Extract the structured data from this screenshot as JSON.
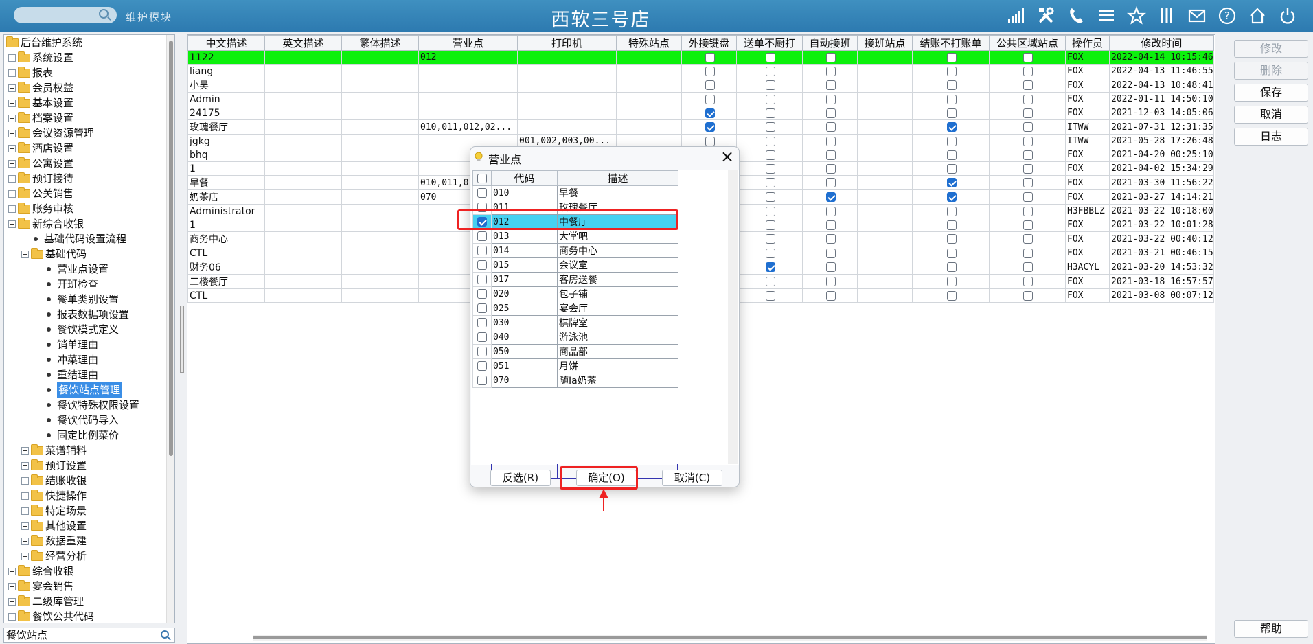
{
  "topbar": {
    "search_placeholder": "",
    "module_label": "维护模块",
    "store_title": "西软三号店",
    "icons": [
      "signal-icon",
      "tools-icon",
      "phone-icon",
      "menu-icon",
      "star-icon",
      "columns-icon",
      "mail-icon",
      "help-icon",
      "home-icon",
      "power-icon"
    ]
  },
  "tree": {
    "items": [
      {
        "label": "后台维护系统",
        "type": "root"
      },
      {
        "label": "系统设置",
        "type": "folder",
        "state": "plus"
      },
      {
        "label": "报表",
        "type": "folder",
        "state": "plus"
      },
      {
        "label": "会员权益",
        "type": "folder",
        "state": "plus"
      },
      {
        "label": "基本设置",
        "type": "folder",
        "state": "plus"
      },
      {
        "label": "档案设置",
        "type": "folder",
        "state": "plus"
      },
      {
        "label": "会议资源管理",
        "type": "folder",
        "state": "plus"
      },
      {
        "label": "酒店设置",
        "type": "folder",
        "state": "plus"
      },
      {
        "label": "公寓设置",
        "type": "folder",
        "state": "plus"
      },
      {
        "label": "预订接待",
        "type": "folder",
        "state": "plus"
      },
      {
        "label": "公关销售",
        "type": "folder",
        "state": "plus"
      },
      {
        "label": "账务审核",
        "type": "folder",
        "state": "plus"
      },
      {
        "label": "新综合收银",
        "type": "folder",
        "state": "minus"
      },
      {
        "label": "基础代码设置流程",
        "type": "leaf",
        "level": 1
      },
      {
        "label": "基础代码",
        "type": "folder",
        "state": "minus",
        "level": 1
      },
      {
        "label": "营业点设置",
        "type": "leaf",
        "level": 2
      },
      {
        "label": "开班检查",
        "type": "leaf",
        "level": 2
      },
      {
        "label": "餐单类别设置",
        "type": "leaf",
        "level": 2
      },
      {
        "label": "报表数据项设置",
        "type": "leaf",
        "level": 2
      },
      {
        "label": "餐饮模式定义",
        "type": "leaf",
        "level": 2
      },
      {
        "label": "销单理由",
        "type": "leaf",
        "level": 2
      },
      {
        "label": "冲菜理由",
        "type": "leaf",
        "level": 2
      },
      {
        "label": "重结理由",
        "type": "leaf",
        "level": 2
      },
      {
        "label": "餐饮站点管理",
        "type": "leaf",
        "level": 2,
        "selected": true
      },
      {
        "label": "餐饮特殊权限设置",
        "type": "leaf",
        "level": 2
      },
      {
        "label": "餐饮代码导入",
        "type": "leaf",
        "level": 2
      },
      {
        "label": "固定比例菜价",
        "type": "leaf",
        "level": 2
      },
      {
        "label": "菜谱辅料",
        "type": "folder",
        "state": "plus",
        "level": 1
      },
      {
        "label": "预订设置",
        "type": "folder",
        "state": "plus",
        "level": 1
      },
      {
        "label": "结账收银",
        "type": "folder",
        "state": "plus",
        "level": 1
      },
      {
        "label": "快捷操作",
        "type": "folder",
        "state": "plus",
        "level": 1
      },
      {
        "label": "特定场景",
        "type": "folder",
        "state": "plus",
        "level": 1
      },
      {
        "label": "其他设置",
        "type": "folder",
        "state": "plus",
        "level": 1
      },
      {
        "label": "数据重建",
        "type": "folder",
        "state": "plus",
        "level": 1
      },
      {
        "label": "经营分析",
        "type": "folder",
        "state": "plus",
        "level": 1
      },
      {
        "label": "综合收银",
        "type": "folder",
        "state": "plus"
      },
      {
        "label": "宴会销售",
        "type": "folder",
        "state": "plus"
      },
      {
        "label": "二级库管理",
        "type": "folder",
        "state": "plus"
      },
      {
        "label": "餐饮公共代码",
        "type": "folder",
        "state": "plus"
      }
    ],
    "search_value": "餐饮站点"
  },
  "grid": {
    "columns": [
      "中文描述",
      "英文描述",
      "繁体描述",
      "营业点",
      "打印机",
      "特殊站点",
      "外接键盘",
      "送单不厨打",
      "自动接班",
      "接班站点",
      "结账不打账单",
      "公共区域站点",
      "操作员",
      "修改时间"
    ],
    "rows": [
      {
        "cn": "1122",
        "en": "",
        "tw": "",
        "outlet": "012",
        "printer": "",
        "special": "",
        "kb": false,
        "nokit": false,
        "auto": false,
        "site": "",
        "nobill": false,
        "pub": false,
        "op": "FOX",
        "time": "2022-04-14 10:15:46"
      },
      {
        "cn": "liang",
        "en": "",
        "tw": "",
        "outlet": "",
        "printer": "",
        "special": "",
        "kb": false,
        "nokit": false,
        "auto": false,
        "site": "",
        "nobill": false,
        "pub": false,
        "op": "FOX",
        "time": "2022-04-13 11:46:55"
      },
      {
        "cn": "小吴",
        "en": "",
        "tw": "",
        "outlet": "",
        "printer": "",
        "special": "",
        "kb": false,
        "nokit": false,
        "auto": false,
        "site": "",
        "nobill": false,
        "pub": false,
        "op": "FOX",
        "time": "2022-04-13 10:48:41"
      },
      {
        "cn": "Admin",
        "en": "",
        "tw": "",
        "outlet": "",
        "printer": "",
        "special": "",
        "kb": false,
        "nokit": false,
        "auto": false,
        "site": "",
        "nobill": false,
        "pub": false,
        "op": "FOX",
        "time": "2022-01-11 14:50:10"
      },
      {
        "cn": "24175",
        "en": "",
        "tw": "",
        "outlet": "",
        "printer": "",
        "special": "",
        "kb": true,
        "nokit": false,
        "auto": false,
        "site": "",
        "nobill": false,
        "pub": false,
        "op": "FOX",
        "time": "2021-12-03 14:05:06"
      },
      {
        "cn": "玫瑰餐厅",
        "en": "",
        "tw": "",
        "outlet": "010,011,012,02...",
        "printer": "",
        "special": "",
        "kb": true,
        "nokit": false,
        "auto": false,
        "site": "",
        "nobill": true,
        "pub": false,
        "op": "ITWW",
        "time": "2021-07-31 12:31:35"
      },
      {
        "cn": "jgkg",
        "en": "",
        "tw": "",
        "outlet": "",
        "printer": "001,002,003,00...",
        "special": "",
        "kb": false,
        "nokit": false,
        "auto": false,
        "site": "",
        "nobill": false,
        "pub": false,
        "op": "ITWW",
        "time": "2021-05-28 17:26:48"
      },
      {
        "cn": "bhq",
        "en": "",
        "tw": "",
        "outlet": "",
        "printer": "",
        "special": "",
        "kb": false,
        "nokit": false,
        "auto": false,
        "site": "",
        "nobill": false,
        "pub": false,
        "op": "FOX",
        "time": "2021-04-20 00:25:10"
      },
      {
        "cn": "1",
        "en": "",
        "tw": "",
        "outlet": "",
        "printer": "",
        "special": "",
        "kb": false,
        "nokit": false,
        "auto": false,
        "site": "",
        "nobill": false,
        "pub": false,
        "op": "FOX",
        "time": "2021-04-02 15:34:29"
      },
      {
        "cn": "早餐",
        "en": "",
        "tw": "",
        "outlet": "010,011,0",
        "printer": "",
        "special": "",
        "kb": false,
        "nokit": false,
        "auto": false,
        "site": "",
        "nobill": true,
        "pub": false,
        "op": "FOX",
        "time": "2021-03-30 11:56:22"
      },
      {
        "cn": "奶茶店",
        "en": "",
        "tw": "",
        "outlet": "070",
        "printer": "",
        "special": "",
        "kb": false,
        "nokit": false,
        "auto": true,
        "site": "",
        "nobill": true,
        "pub": false,
        "op": "FOX",
        "time": "2021-03-27 14:14:21"
      },
      {
        "cn": "Administrator",
        "en": "",
        "tw": "",
        "outlet": "",
        "printer": "",
        "special": "",
        "kb": false,
        "nokit": false,
        "auto": false,
        "site": "",
        "nobill": false,
        "pub": false,
        "op": "H3FBBLZ",
        "time": "2021-03-22 10:18:00"
      },
      {
        "cn": "1",
        "en": "",
        "tw": "",
        "outlet": "",
        "printer": "",
        "special": "",
        "kb": false,
        "nokit": false,
        "auto": false,
        "site": "",
        "nobill": false,
        "pub": false,
        "op": "FOX",
        "time": "2021-03-22 10:01:28"
      },
      {
        "cn": "商务中心",
        "en": "",
        "tw": "",
        "outlet": "",
        "printer": "",
        "special": "",
        "kb": false,
        "nokit": false,
        "auto": false,
        "site": "",
        "nobill": false,
        "pub": false,
        "op": "FOX",
        "time": "2021-03-22 00:40:12"
      },
      {
        "cn": "CTL",
        "en": "",
        "tw": "",
        "outlet": "",
        "printer": "",
        "special": "",
        "kb": false,
        "nokit": false,
        "auto": false,
        "site": "",
        "nobill": false,
        "pub": false,
        "op": "FOX",
        "time": "2021-03-21 00:46:15"
      },
      {
        "cn": "财务06",
        "en": "",
        "tw": "",
        "outlet": "",
        "printer": "",
        "special": "",
        "kb": false,
        "nokit": true,
        "auto": false,
        "site": "",
        "nobill": false,
        "pub": false,
        "op": "H3ACYL",
        "time": "2021-03-20 14:53:32"
      },
      {
        "cn": "二楼餐厅",
        "en": "",
        "tw": "",
        "outlet": "",
        "printer": "",
        "special": "",
        "kb": false,
        "nokit": false,
        "auto": false,
        "site": "",
        "nobill": false,
        "pub": false,
        "op": "FOX",
        "time": "2021-03-18 16:57:57"
      },
      {
        "cn": "CTL",
        "en": "",
        "tw": "",
        "outlet": "",
        "printer": "",
        "special": "",
        "kb": false,
        "nokit": false,
        "auto": false,
        "site": "",
        "nobill": false,
        "pub": false,
        "op": "FOX",
        "time": "2021-03-08 00:07:12"
      }
    ]
  },
  "right_buttons": {
    "modify": "修改",
    "delete": "删除",
    "save": "保存",
    "cancel": "取消",
    "log": "日志",
    "help": "帮助"
  },
  "dialog": {
    "title": "营业点",
    "columns": [
      "代码",
      "描述"
    ],
    "rows": [
      {
        "code": "010",
        "desc": "早餐",
        "checked": false
      },
      {
        "code": "011",
        "desc": "玫瑰餐厅",
        "checked": false
      },
      {
        "code": "012",
        "desc": "中餐厅",
        "checked": true
      },
      {
        "code": "013",
        "desc": "大堂吧",
        "checked": false
      },
      {
        "code": "014",
        "desc": "商务中心",
        "checked": false
      },
      {
        "code": "015",
        "desc": "会议室",
        "checked": false
      },
      {
        "code": "017",
        "desc": "客房送餐",
        "checked": false
      },
      {
        "code": "020",
        "desc": "包子铺",
        "checked": false
      },
      {
        "code": "025",
        "desc": "宴会厅",
        "checked": false
      },
      {
        "code": "030",
        "desc": "棋牌室",
        "checked": false
      },
      {
        "code": "040",
        "desc": "游泳池",
        "checked": false
      },
      {
        "code": "050",
        "desc": "商品部",
        "checked": false
      },
      {
        "code": "051",
        "desc": "月饼",
        "checked": false
      },
      {
        "code": "070",
        "desc": "随Ia奶茶",
        "checked": false
      }
    ],
    "buttons": {
      "invert": "反选(R)",
      "confirm": "确定(O)",
      "cancel": "取消(C)"
    }
  },
  "colors": {
    "topbar": "#2d7ab0",
    "highlight_row": "#0cf00c",
    "dialog_selected_row": "#47d1f0",
    "annotation": "#ee2222",
    "tree_selected": "#3a8ee6"
  }
}
